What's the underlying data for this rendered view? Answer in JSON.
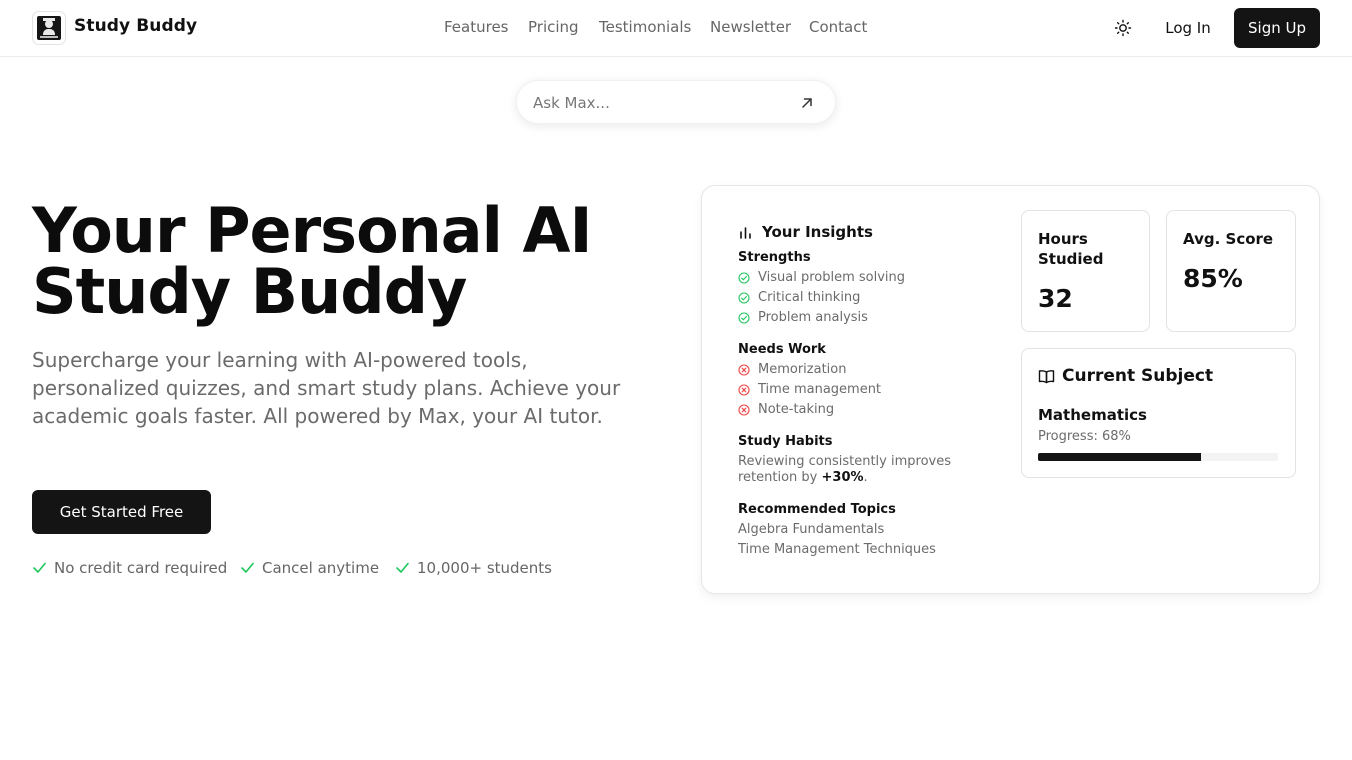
{
  "header": {
    "brand": "Study Buddy",
    "nav": [
      "Features",
      "Pricing",
      "Testimonials",
      "Newsletter",
      "Contact"
    ],
    "theme_toggle_icon": "sun-icon",
    "login": "Log In",
    "signup": "Sign Up"
  },
  "ask": {
    "placeholder": "Ask Max...",
    "submit_icon": "arrow-up-right-icon"
  },
  "hero": {
    "title": "Your Personal AI Study Buddy",
    "subtitle": "Supercharge your learning with AI-powered tools, personalized quizzes, and smart study plans. Achieve your academic goals faster. All powered by Max, your AI tutor.",
    "cta": "Get Started Free",
    "perks": [
      "No credit card required",
      "Cancel anytime",
      "10,000+ students"
    ]
  },
  "insights": {
    "title": "Your Insights",
    "strengths_title": "Strengths",
    "strengths": [
      "Visual problem solving",
      "Critical thinking",
      "Problem analysis"
    ],
    "needs_title": "Needs Work",
    "needs": [
      "Memorization",
      "Time management",
      "Note-taking"
    ],
    "habits_title": "Study Habits",
    "habits_text": "Reviewing consistently improves retention by",
    "habits_highlight": "+30%",
    "habits_end": ".",
    "topics_title": "Recommended Topics",
    "topics": [
      "Algebra Fundamentals",
      "Time Management Techniques"
    ]
  },
  "stats": {
    "hours_label": "Hours Studied",
    "hours_value": "32",
    "score_label": "Avg. Score",
    "score_value": "85%"
  },
  "subject": {
    "title": "Current Subject",
    "name": "Mathematics",
    "progress_label": "Progress: 68%",
    "progress": 0.68
  },
  "colors": {
    "accent": "#141414",
    "positive": "#22c55e",
    "negative": "#ef4444",
    "muted_text": "#6b6b6b"
  }
}
